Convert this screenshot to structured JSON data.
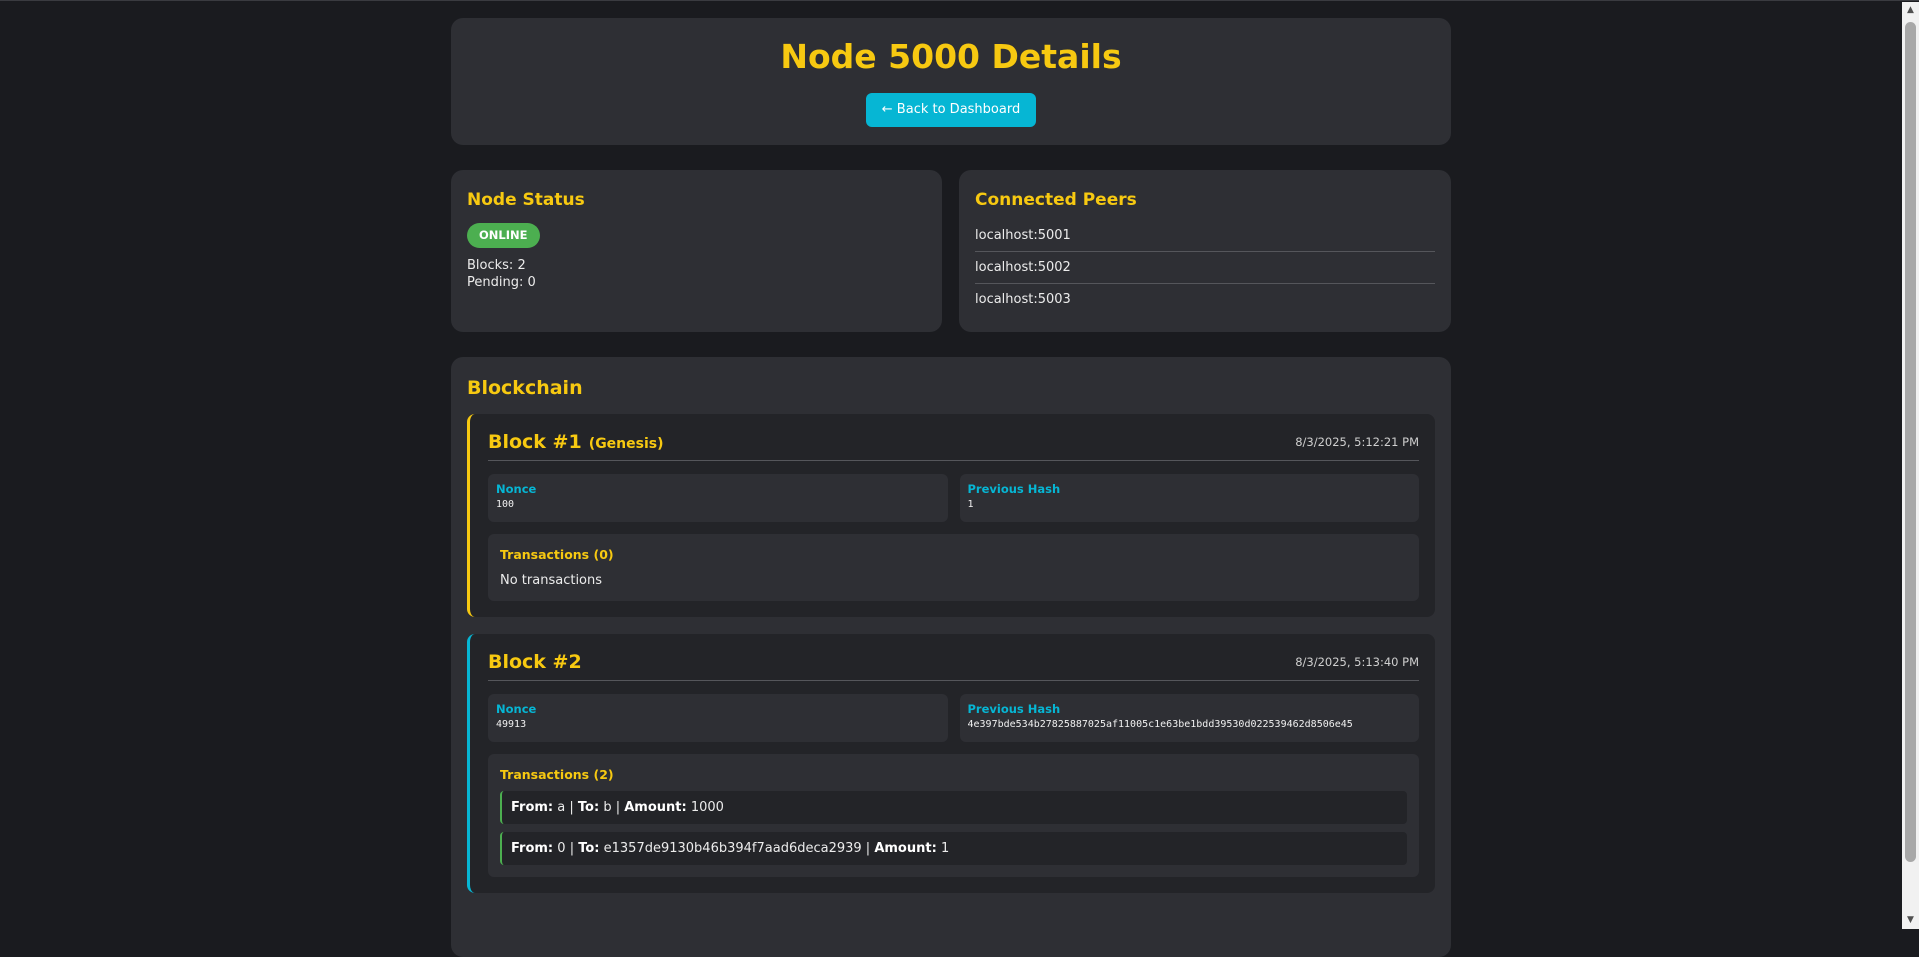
{
  "header": {
    "title": "Node 5000 Details",
    "back_label": "← Back to Dashboard"
  },
  "status": {
    "title": "Node Status",
    "badge": "ONLINE",
    "blocks": "Blocks: 2",
    "pending": "Pending: 0",
    "badge_color": "#4caf50"
  },
  "peers": {
    "title": "Connected Peers",
    "items": [
      "localhost:5001",
      "localhost:5002",
      "localhost:5003"
    ]
  },
  "chain": {
    "title": "Blockchain",
    "blocks": [
      {
        "title": "Block #1",
        "tag": "(Genesis)",
        "time": "8/3/2025, 5:12:21 PM",
        "nonce_label": "Nonce",
        "nonce": "100",
        "prev_label": "Previous Hash",
        "prev_hash": "1",
        "tx_title": "Transactions (0)",
        "tx_empty": "No transactions"
      },
      {
        "title": "Block #2",
        "time": "8/3/2025, 5:13:40 PM",
        "nonce_label": "Nonce",
        "nonce": "49913",
        "prev_label": "Previous Hash",
        "prev_hash": "4e397bde534b27825887025af11005c1e63be1bdd39530d022539462d8506e45",
        "tx_title": "Transactions (2)",
        "transactions": [
          {
            "from_label": "From:",
            "from": "a",
            "to_label": "To:",
            "to": "b",
            "amount_label": "Amount:",
            "amount": "1000"
          },
          {
            "from_label": "From:",
            "from": "0",
            "to_label": "To:",
            "to": "e1357de9130b46b394f7aad6deca2939",
            "amount_label": "Amount:",
            "amount": "1"
          }
        ]
      }
    ]
  },
  "colors": {
    "accent": "#f7c911",
    "link": "#06b6d4",
    "background": "#1a1b1f",
    "card": "#2e2f34"
  }
}
